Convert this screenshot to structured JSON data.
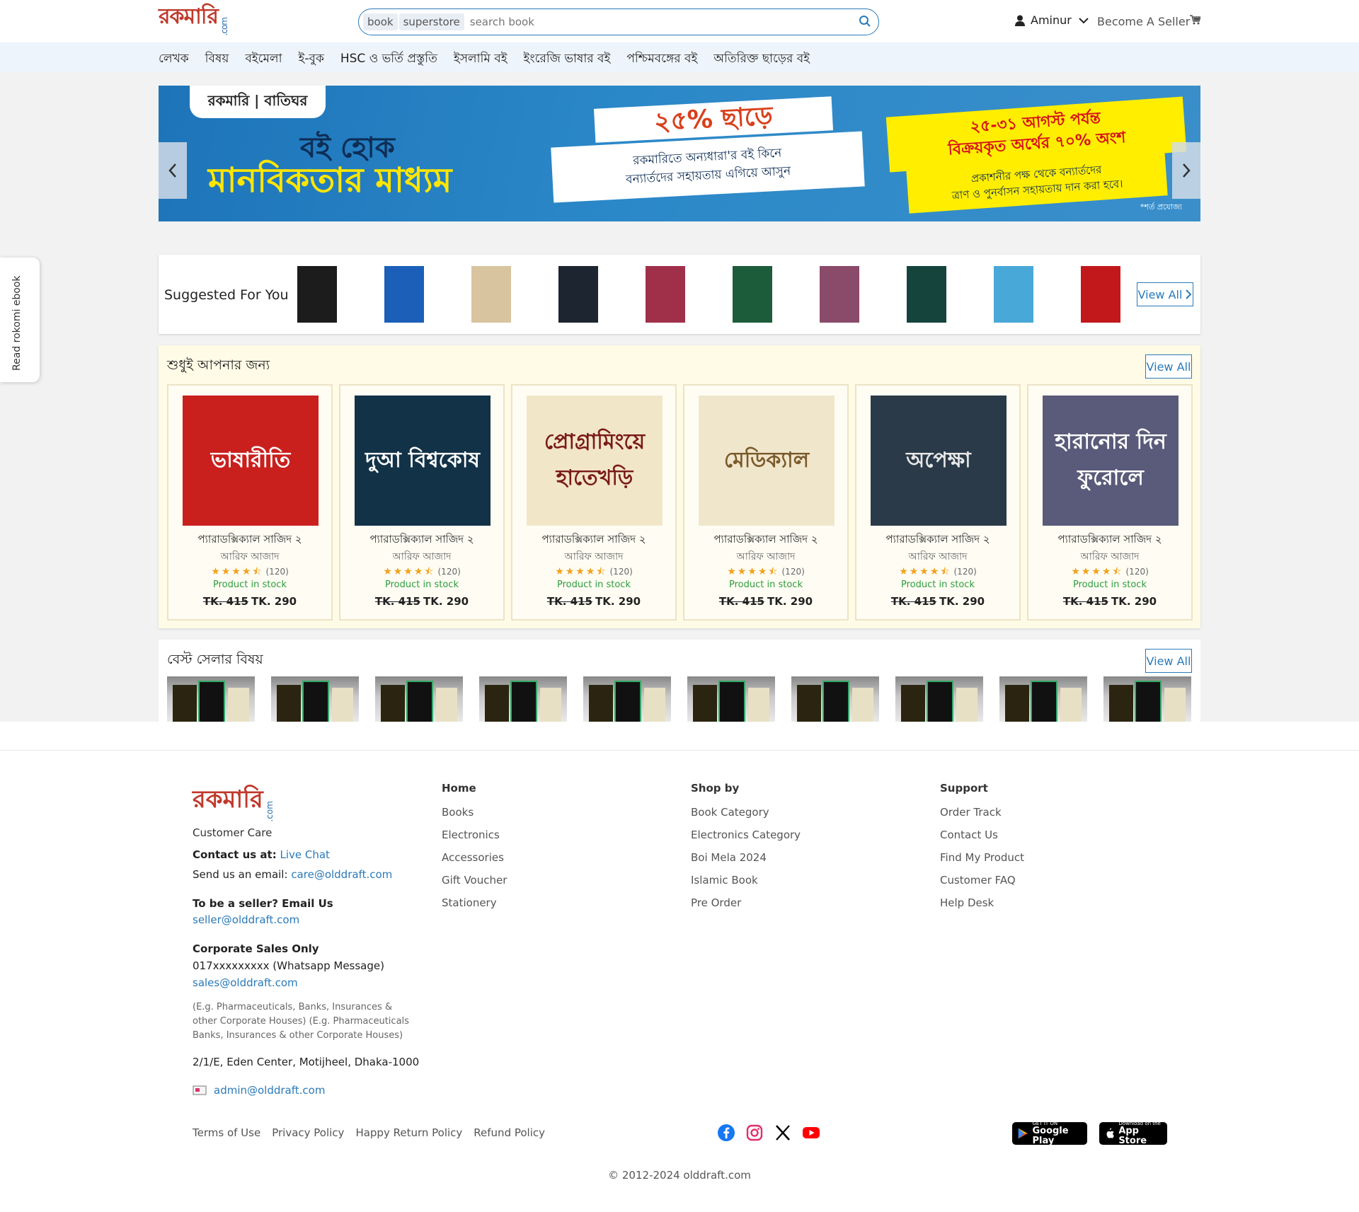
{
  "header": {
    "logo_text": "রকমারি",
    "logo_suffix": ".com",
    "search_tags": [
      "book",
      "superstore"
    ],
    "search_placeholder": "search book",
    "user_name": "Aminur",
    "become_seller": "Become A Seller"
  },
  "nav": [
    "লেখক",
    "বিষয়",
    "বইমেলা",
    "ই-বুক",
    "HSC ও ভর্তি প্রস্তুতি",
    "ইসলামি বই",
    "ইংরেজি ভাষার বই",
    "পশ্চিমবঙ্গের বই",
    "অতিরিক্ত ছাড়ের বই"
  ],
  "banner": {
    "brand": "রকমারি | বাতিঘর",
    "headline1": "বই হোক",
    "headline2": "মানবিকতার মাধ্যম",
    "discount": "২৫% ছাড়ে",
    "offer_line1": "রকমারিতে অন্যধারা'র বই কিনে",
    "offer_line2": "বন্যার্তদের সহায়তায় এগিয়ে আসুন",
    "date_line1": "২৫-৩১ আগস্ট পর্যন্ত",
    "date_line2": "বিক্রয়কৃত অর্থের ৭০% অংশ",
    "donate_line1": "প্রকাশনীর পক্ষ থেকে বন্যার্তদের",
    "donate_line2": "ত্রাণ ও পুনর্বাসন সহায়তায় দান করা হবে।",
    "note": "*শর্ত প্রযোজ্য"
  },
  "suggested": {
    "title": "Suggested For You",
    "view_all": "View All",
    "items": [
      {
        "name": "english-book",
        "color": "#1c1c1c"
      },
      {
        "name": "lotion-tube",
        "color": "#1b5fb8"
      },
      {
        "name": "guide-book",
        "color": "#d9c4a0"
      },
      {
        "name": "umbrella",
        "color": "#1c2530"
      },
      {
        "name": "hair-straightener",
        "color": "#a0304a"
      },
      {
        "name": "green-book",
        "color": "#1c5c3a"
      },
      {
        "name": "pen",
        "color": "#8a4a6a"
      },
      {
        "name": "spoken-english-book",
        "color": "#14443c"
      },
      {
        "name": "toothpaste-box",
        "color": "#48a8d8"
      },
      {
        "name": "bhasharīti-book",
        "color": "#c2181c"
      }
    ]
  },
  "for_you": {
    "title": "শুধুই আপনার জন্য",
    "view_all": "View All",
    "products": [
      {
        "cover_text": "ভাষারীতি",
        "cover_bg": "#c9201e",
        "cover_fg": "#fff",
        "name": "প্যারাডক্সিক্যাল সাজিদ ২",
        "author": "আরিফ আজাদ",
        "reviews": "(120)",
        "stock": "Product in stock",
        "old_price": "TK. 415",
        "price": "TK. 290"
      },
      {
        "cover_text": "দুআ বিশ্বকোষ",
        "cover_bg": "#123248",
        "cover_fg": "#fff",
        "name": "প্যারাডক্সিক্যাল সাজিদ ২",
        "author": "আরিফ আজাদ",
        "reviews": "(120)",
        "stock": "Product in stock",
        "old_price": "TK. 415",
        "price": "TK. 290"
      },
      {
        "cover_text": "প্রোগ্রামিংয়ে হাতেখড়ি",
        "cover_bg": "#f2e6c8",
        "cover_fg": "#7a1a1a",
        "name": "প্যারাডক্সিক্যাল সাজিদ ২",
        "author": "আরিফ আজাদ",
        "reviews": "(120)",
        "stock": "Product in stock",
        "old_price": "TK. 415",
        "price": "TK. 290"
      },
      {
        "cover_text": "মেডিক্যাল",
        "cover_bg": "#f0e6cc",
        "cover_fg": "#7a5a2a",
        "name": "প্যারাডক্সিক্যাল সাজিদ ২",
        "author": "আরিফ আজাদ",
        "reviews": "(120)",
        "stock": "Product in stock",
        "old_price": "TK. 415",
        "price": "TK. 290"
      },
      {
        "cover_text": "অপেক্ষা",
        "cover_bg": "#2a3a48",
        "cover_fg": "#e8e8e8",
        "name": "প্যারাডক্সিক্যাল সাজিদ ২",
        "author": "আরিফ আজাদ",
        "reviews": "(120)",
        "stock": "Product in stock",
        "old_price": "TK. 415",
        "price": "TK. 290"
      },
      {
        "cover_text": "হারানোর দিন ফুরোলে",
        "cover_bg": "#5a5a7a",
        "cover_fg": "#fff",
        "name": "প্যারাডক্সিক্যাল সাজিদ ২",
        "author": "আরিফ আজাদ",
        "reviews": "(120)",
        "stock": "Product in stock",
        "old_price": "TK. 415",
        "price": "TK. 290"
      }
    ]
  },
  "best_seller": {
    "title": "বেস্ট সেলার বিষয়",
    "view_all": "View All"
  },
  "sidebar_tab": "Read rokomi ebook",
  "footer": {
    "logo_text": "রকমারি",
    "logo_suffix": ".com",
    "customer_care": "Customer Care",
    "contact_label": "Contact us at:",
    "live_chat": "Live Chat",
    "email_label": "Send us an email:",
    "care_email": "care@olddraft.com",
    "seller_label": "To be a seller? Email Us",
    "seller_email": "seller@olddraft.com",
    "corporate_label": "Corporate Sales Only",
    "phone": "017xxxxxxxxx (Whatsapp Message)",
    "sales_email": "sales@olddraft.com",
    "corporate_note": "(E.g. Pharmaceuticals, Banks, Insurances & other Corporate Houses) (E.g. Pharmaceuticals Banks, Insurances & other Corporate Houses)",
    "address": "2/1/E, Eden Center, Motijheel, Dhaka-1000",
    "admin_email": "admin@olddraft.com",
    "col_home": {
      "title": "Home",
      "links": [
        "Books",
        "Electronics",
        "Accessories",
        "Gift Voucher",
        "Stationery"
      ]
    },
    "col_shop": {
      "title": "Shop by",
      "links": [
        "Book Category",
        "Electronics Category",
        "Boi Mela 2024",
        "Islamic Book",
        "Pre Order"
      ]
    },
    "col_support": {
      "title": "Support",
      "links": [
        "Order Track",
        "Contact Us",
        "Find My Product",
        "Customer FAQ",
        "Help Desk"
      ]
    },
    "policies": [
      "Terms of Use",
      "Privacy Policy",
      "Happy Return Policy",
      "Refund Policy"
    ],
    "google_play_small": "GET IT ON",
    "google_play": "Google Play",
    "app_store_small": "Download on the",
    "app_store": "App Store",
    "copyright": "© 2012-2024 olddraft.com"
  },
  "colors": {
    "accent": "#2a7ab8",
    "stock_green": "#2c9d3c",
    "star": "#f2a01c"
  }
}
